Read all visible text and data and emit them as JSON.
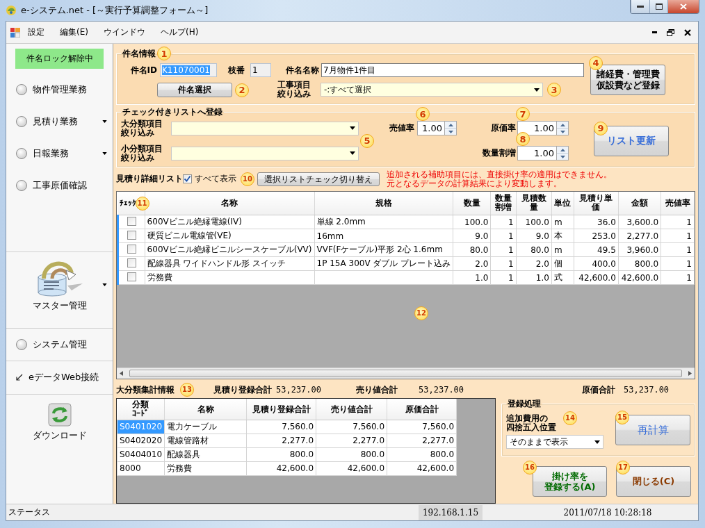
{
  "window": {
    "title": "e-システム.net - [～実行予算調整フォーム～]"
  },
  "menu": [
    "設定",
    "編集(E)",
    "ウインドウ",
    "ヘルプ(H)"
  ],
  "sidebar": {
    "badge": "件名ロック解除中",
    "sections": [
      [
        {
          "kind": "radio",
          "label": "物件管理業務",
          "dropdown": false
        },
        {
          "kind": "radio",
          "label": "見積り業務",
          "dropdown": true
        },
        {
          "kind": "radio",
          "label": "日報業務",
          "dropdown": true
        },
        {
          "kind": "radio",
          "label": "工事原価確認",
          "dropdown": false
        }
      ],
      [
        {
          "kind": "master",
          "label": "マスター管理",
          "dropdown": true
        }
      ],
      [
        {
          "kind": "radio",
          "label": "システム管理",
          "dropdown": false
        }
      ],
      [
        {
          "kind": "link",
          "label": "eデータWeb接続",
          "dropdown": false
        }
      ],
      [
        {
          "kind": "download",
          "label": "ダウンロード",
          "dropdown": false
        }
      ]
    ]
  },
  "project_info": {
    "title": "件名情報",
    "callout": "1",
    "id_label": "件名ID",
    "id_value": "K11070001",
    "id_value_selected": true,
    "branch_label": "枝番",
    "branch_value": "1",
    "name_label": "件名名称",
    "name_value": "7月物件1件目",
    "select_button": "件名選択",
    "select_callout": "2",
    "filter_label": [
      "工事項目",
      "絞り込み"
    ],
    "filter_value": "-:すべて選択",
    "filter_callout": "3",
    "expense_button": [
      "諸経費・管理費",
      "仮設費など登録"
    ],
    "expense_callout": "4"
  },
  "register": {
    "title": "チェック付きリストへ登録",
    "major_label": [
      "大分類項目",
      "絞り込み"
    ],
    "minor_label": [
      "小分類項目",
      "絞り込み"
    ],
    "filter_callout": "5",
    "spinners": [
      {
        "label": "売値率",
        "value": "1.00",
        "callout": "6"
      },
      {
        "label": "原価率",
        "value": "1.00",
        "callout": "7"
      },
      {
        "label": "数量割増",
        "value": "1.00",
        "callout": "8"
      }
    ],
    "update_button": "リスト更新",
    "update_callout": "9"
  },
  "detail_list": {
    "title": "見積り詳細リスト",
    "show_all": {
      "label": "すべて表示",
      "checked": true
    },
    "callout": "10",
    "toggle_button": "選択リストチェック切り替え",
    "notice": [
      "追加される補助項目には、直接掛け率の適用はできません。",
      "元となるデータの計算結果により変動します。"
    ],
    "table": {
      "check_header": "ﾁｪｯｸ",
      "header_callout": "11",
      "area_callout": "12",
      "columns": [
        "名称",
        "規格",
        "数量",
        "数量割増",
        "見積数量",
        "単位",
        "見積り単価",
        "金額",
        "売値率"
      ],
      "rows": [
        {
          "checked": false,
          "cells": [
            "600Vビニル絶縁電線(IV)",
            "単線 2.0mm",
            "100.0",
            "1",
            "100.0",
            "m",
            "36.0",
            "3,600.0",
            "1"
          ]
        },
        {
          "checked": false,
          "cells": [
            "硬質ビニル電線管(VE)",
            "16mm",
            "9.0",
            "1",
            "9.0",
            "本",
            "253.0",
            "2,277.0",
            "1"
          ]
        },
        {
          "checked": false,
          "cells": [
            "600Vビニル絶縁ビニルシースケーブル(VV)",
            "VVF(Fケーブル)平形 2心 1.6mm",
            "80.0",
            "1",
            "80.0",
            "m",
            "49.5",
            "3,960.0",
            "1"
          ]
        },
        {
          "checked": false,
          "cells": [
            "配線器具 ワイドハンドル形 スイッチ",
            "1P 15A 300V ダブル プレート込み",
            "2.0",
            "1",
            "2.0",
            "個",
            "400.0",
            "800.0",
            "1"
          ]
        },
        {
          "checked": false,
          "cells": [
            "労務費",
            null,
            "1.0",
            "1",
            "1.0",
            "式",
            "42,600.0",
            "42,600.0",
            "1"
          ]
        }
      ]
    }
  },
  "summary": {
    "title": "大分類集計情報",
    "callout": "13",
    "totals": [
      {
        "label": "見積り登録合計",
        "value": "53,237.00"
      },
      {
        "label": "売り値合計",
        "value": "53,237.00"
      },
      {
        "label": "原価合計",
        "value": "53,237.00"
      }
    ],
    "table": {
      "columns": [
        "分類ｺｰﾄﾞ",
        "名称",
        "見積り登録合計",
        "売り値合計",
        "原価合計"
      ],
      "rows": [
        {
          "selected": true,
          "cells": [
            "S0401020",
            "電力ケーブル",
            "7,560.0",
            "7,560.0",
            "7,560.0"
          ]
        },
        {
          "selected": false,
          "cells": [
            "S0402020",
            "電線管路材",
            "2,277.0",
            "2,277.0",
            "2,277.0"
          ]
        },
        {
          "selected": false,
          "cells": [
            "S0404010",
            "配線器具",
            "800.0",
            "800.0",
            "800.0"
          ]
        },
        {
          "selected": false,
          "cells": [
            "8000",
            "労務費",
            "42,600.0",
            "42,600.0",
            "42,600.0"
          ]
        }
      ]
    }
  },
  "processing": {
    "title": "登録処理",
    "rounding_label": [
      "追加費用の",
      "四捨五入位置"
    ],
    "rounding_callout": "14",
    "rounding_value": "そのままで表示",
    "recalc_button": "再計算",
    "recalc_callout": "15",
    "rate_button": [
      "掛け率を",
      "登録する(A)"
    ],
    "rate_callout": "16",
    "close_button": "閉じる(C)",
    "close_callout": "17"
  },
  "status_bar": {
    "label": "ステータス",
    "ip": "192.168.1.15",
    "datetime": "2011/07/18 10:28:18"
  }
}
